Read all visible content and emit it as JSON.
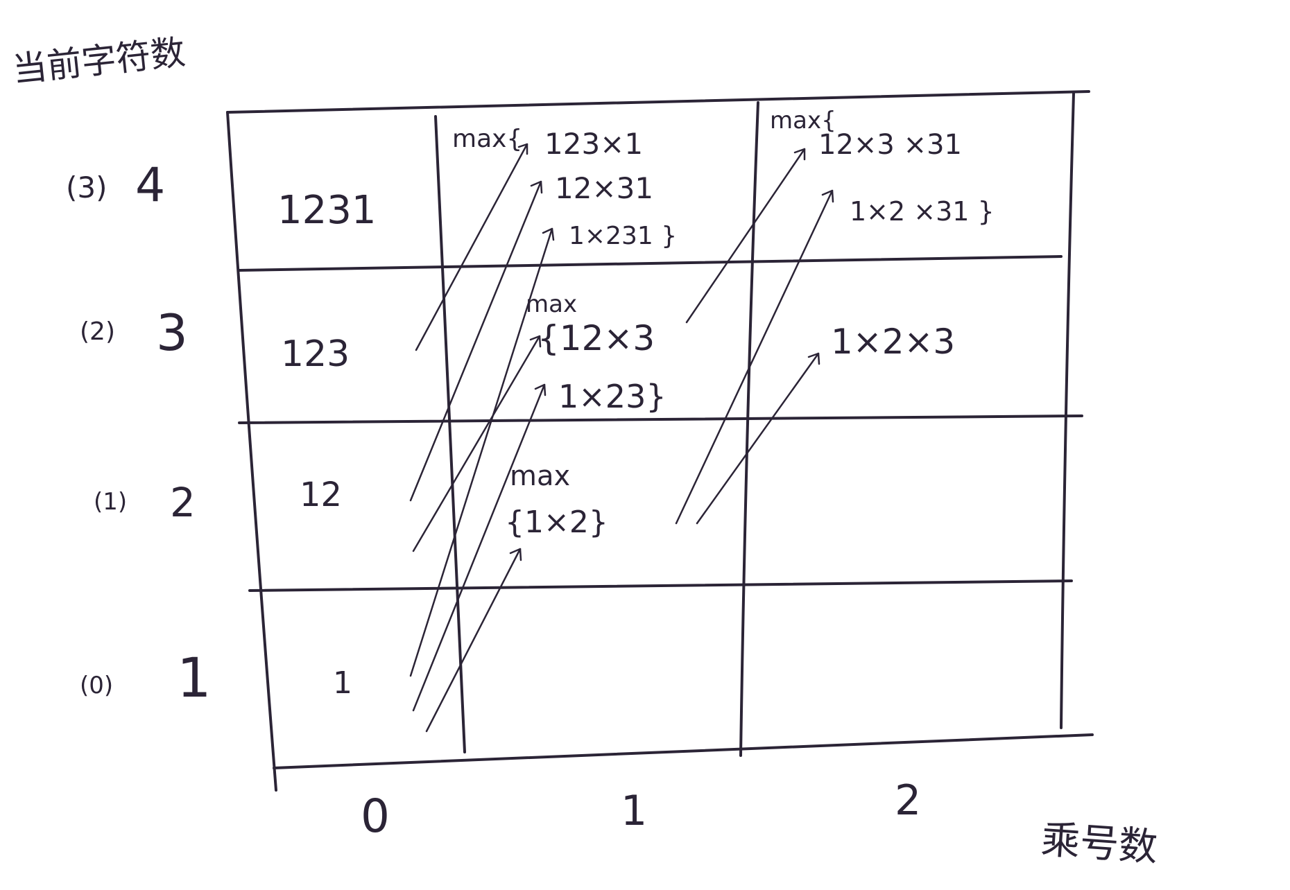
{
  "axes": {
    "y_label": "当前字符数",
    "x_label": "乘号数",
    "x_ticks": [
      "0",
      "1",
      "2"
    ]
  },
  "rows": [
    {
      "index": "(0)",
      "chars": "1",
      "col0": "1"
    },
    {
      "index": "(1)",
      "chars": "2",
      "col0": "12"
    },
    {
      "index": "(2)",
      "chars": "3",
      "col0": "123"
    },
    {
      "index": "(3)",
      "chars": "4",
      "col0": "1231"
    }
  ],
  "cells": {
    "r1c1": {
      "max": "max",
      "opts": [
        "{1×2}"
      ]
    },
    "r2c1": {
      "max": "max",
      "opts": [
        "{12×3",
        "1×23}"
      ]
    },
    "r2c2": {
      "opts": [
        "1×2×3"
      ]
    },
    "r3c1": {
      "max": "max{",
      "opts": [
        "123×1",
        "12×31",
        "1×231 }"
      ]
    },
    "r3c2": {
      "max": "max{",
      "opts": [
        "12×3 ×31",
        "1×2 ×31 }"
      ]
    }
  }
}
